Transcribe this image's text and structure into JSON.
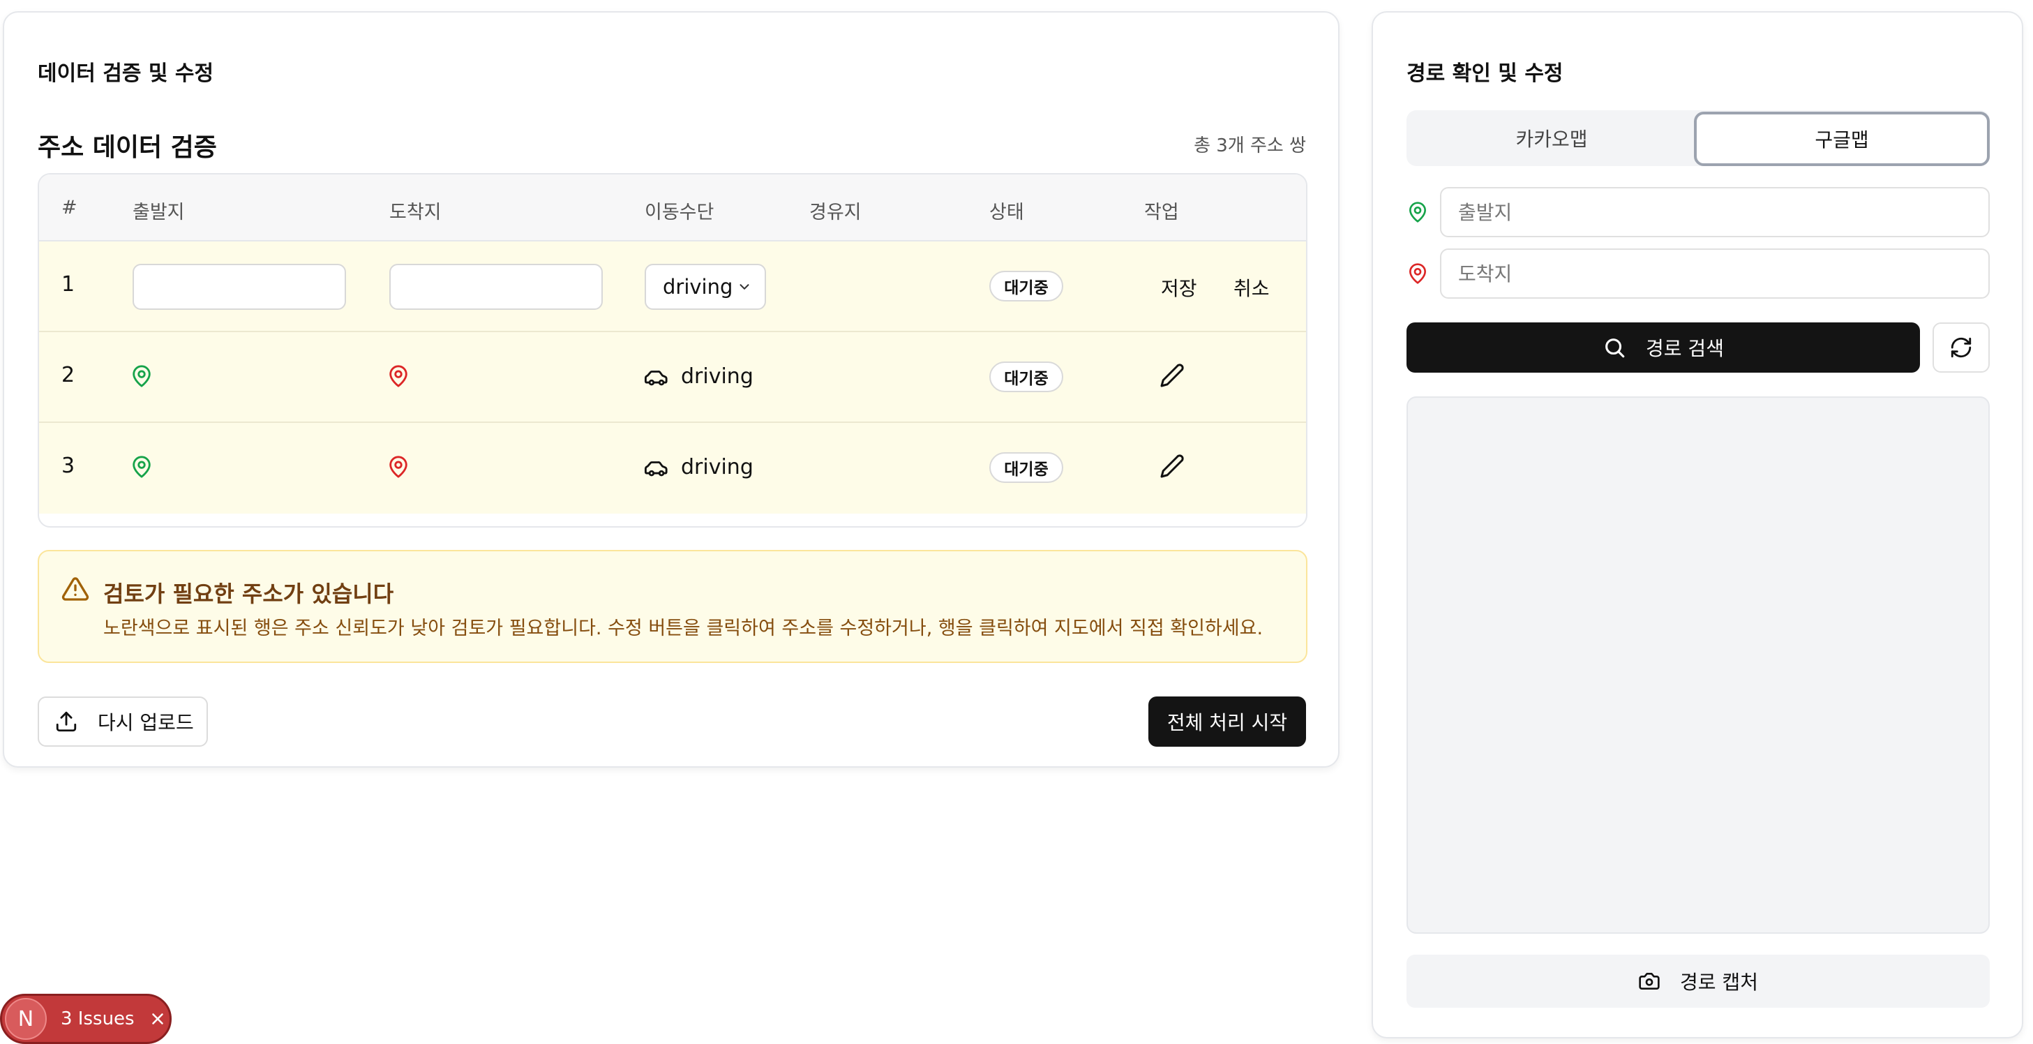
{
  "left_panel": {
    "title": "데이터 검증 및 수정",
    "section_title": "주소 데이터 검증",
    "count_text": "총 3개 주소 쌍",
    "table": {
      "headers": [
        "#",
        "출발지",
        "도착지",
        "이동수단",
        "경유지",
        "상태",
        "작업"
      ],
      "rows": [
        {
          "num": "1",
          "mode": "driving",
          "status": "대기중",
          "editing": true,
          "save_label": "저장",
          "cancel_label": "취소"
        },
        {
          "num": "2",
          "mode": "driving",
          "status": "대기중",
          "editing": false
        },
        {
          "num": "3",
          "mode": "driving",
          "status": "대기중",
          "editing": false
        }
      ]
    },
    "warning": {
      "title": "검토가 필요한 주소가 있습니다",
      "text": "노란색으로 표시된 행은 주소 신뢰도가 낮아 검토가 필요합니다. 수정 버튼을 클릭하여 주소를 수정하거나, 행을 클릭하여 지도에서 직접 확인하세요."
    },
    "reupload_label": "다시 업로드",
    "start_all_label": "전체 처리 시작"
  },
  "right_panel": {
    "title": "경로 확인 및 수정",
    "tabs": [
      {
        "label": "카카오맵",
        "active": false
      },
      {
        "label": "구글맵",
        "active": true
      }
    ],
    "origin_placeholder": "출발지",
    "destination_placeholder": "도착지",
    "search_label": "경로 검색",
    "capture_label": "경로 캡처"
  },
  "issues_badge": {
    "logo": "N",
    "label": "3 Issues"
  },
  "colors": {
    "origin_pin": "#16a34a",
    "destination_pin": "#dc2626",
    "row_highlight": "#fefce8",
    "warning_text": "#854d0e",
    "dark_button": "#141414"
  }
}
